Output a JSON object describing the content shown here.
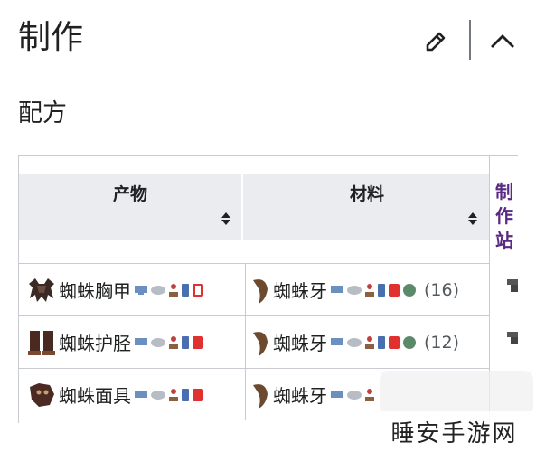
{
  "section": {
    "title": "制作",
    "subtitle": "配方"
  },
  "table": {
    "headers": {
      "product": "产物",
      "materials": "材料",
      "station": "制作站"
    },
    "rows": [
      {
        "product": "蜘蛛胸甲",
        "material": "蜘蛛牙",
        "qty": "(16)"
      },
      {
        "product": "蜘蛛护胫",
        "material": "蜘蛛牙",
        "qty": "(12)"
      },
      {
        "product": "蜘蛛面具",
        "material": "蜘蛛牙",
        "qty": ""
      }
    ]
  },
  "icons": {
    "edit": "pencil-icon",
    "collapse": "chevron-up-icon",
    "sort": "sort-icon",
    "platforms": [
      "pc-icon",
      "console-icon",
      "mobile-icon",
      "joystick-icon",
      "switch-icon",
      "tmodloader-icon"
    ]
  },
  "colors": {
    "accent_purple": "#5a2a82",
    "header_bg": "#eaecf0",
    "border": "#c8ccd1"
  },
  "watermark": "睡安手游网"
}
